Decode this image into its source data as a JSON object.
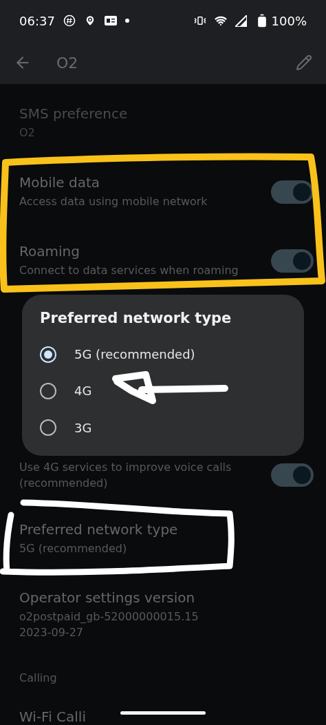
{
  "status_bar": {
    "time": "06:37",
    "battery": "100%"
  },
  "app_bar": {
    "title": "O2"
  },
  "settings_top": [
    {
      "kind": "text",
      "title": "SMS preference",
      "summary": "O2",
      "disabled": true
    },
    {
      "kind": "toggle",
      "title": "Mobile data",
      "summary": "Access data using mobile network",
      "on": true
    },
    {
      "kind": "toggle",
      "title": "Roaming",
      "summary": "Connect to data services when roaming",
      "on": true
    }
  ],
  "dialog": {
    "title": "Preferred network type",
    "options": [
      {
        "label": "5G (recommended)",
        "selected": true
      },
      {
        "label": "4G",
        "selected": false
      },
      {
        "label": "3G",
        "selected": false
      }
    ]
  },
  "settings_bottom": [
    {
      "kind": "toggle",
      "summary": "Use 4G services to improve voice calls (recommended)",
      "on": true
    },
    {
      "kind": "text",
      "title": "Preferred network type",
      "summary": "5G (recommended)"
    },
    {
      "kind": "text",
      "title": "Operator settings version",
      "summary": "o2postpaid_gb-52000000015.15\n2023-09-27"
    },
    {
      "kind": "header",
      "title": "Calling"
    },
    {
      "kind": "text",
      "title": "Wi-Fi Calli"
    }
  ]
}
